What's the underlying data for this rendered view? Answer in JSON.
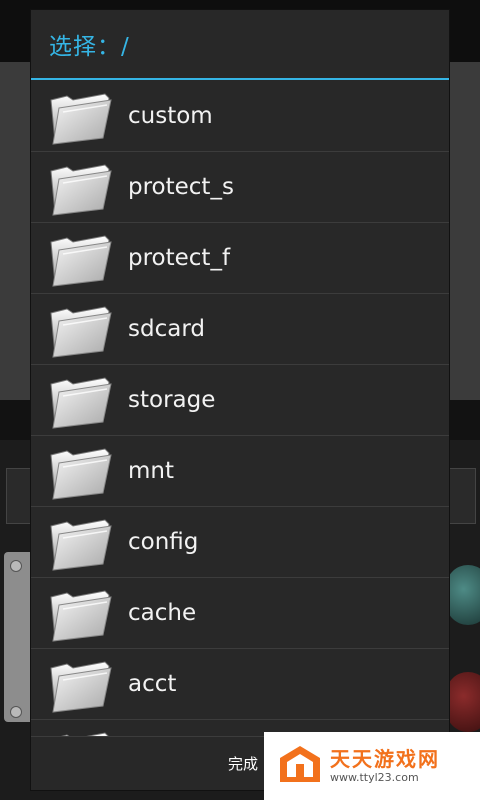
{
  "dialog": {
    "title": "选择：/",
    "accent_color": "#35b5e5",
    "items": [
      {
        "label": "custom",
        "icon": "folder-icon"
      },
      {
        "label": "protect_s",
        "icon": "folder-icon"
      },
      {
        "label": "protect_f",
        "icon": "folder-icon"
      },
      {
        "label": "sdcard",
        "icon": "folder-icon"
      },
      {
        "label": "storage",
        "icon": "folder-icon"
      },
      {
        "label": "mnt",
        "icon": "folder-icon"
      },
      {
        "label": "config",
        "icon": "folder-icon"
      },
      {
        "label": "cache",
        "icon": "folder-icon"
      },
      {
        "label": "acct",
        "icon": "folder-icon"
      },
      {
        "label": "",
        "icon": "folder-icon"
      }
    ],
    "done_label": "完成"
  },
  "watermark": {
    "name": "天天游戏网",
    "url": "www.ttyl23.com",
    "color": "#f2711c"
  }
}
